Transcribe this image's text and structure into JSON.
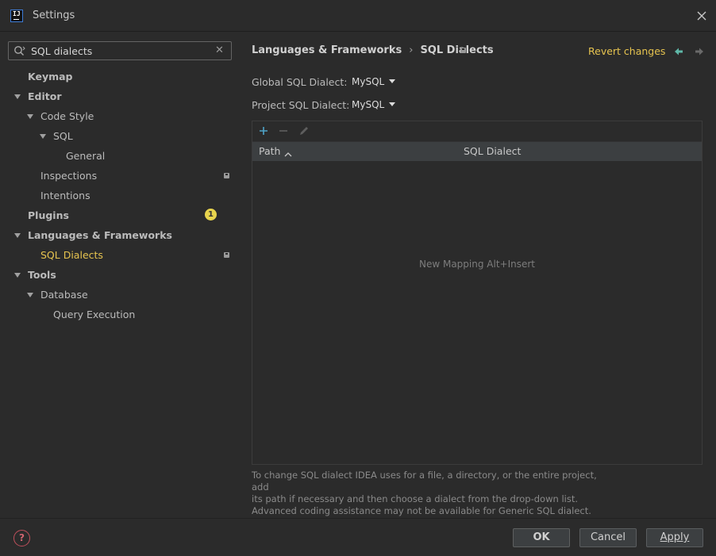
{
  "window": {
    "title": "Settings",
    "app_icon_text": "IJ"
  },
  "search": {
    "value": "SQL dialects",
    "placeholder": ""
  },
  "tree": {
    "keymap": "Keymap",
    "editor": "Editor",
    "code_style": "Code Style",
    "sql": "SQL",
    "general": "General",
    "inspections": "Inspections",
    "intentions": "Intentions",
    "plugins": "Plugins",
    "plugins_badge": "1",
    "languages": "Languages & Frameworks",
    "sql_dialects": "SQL Dialects",
    "tools": "Tools",
    "database": "Database",
    "query_execution": "Query Execution"
  },
  "header": {
    "breadcrumb_parent": "Languages & Frameworks",
    "breadcrumb_sep": "›",
    "breadcrumb_current": "SQL Dialects",
    "revert": "Revert changes"
  },
  "fields": {
    "global_label": "Global SQL Dialect:",
    "global_value": "MySQL",
    "project_label": "Project SQL Dialect:",
    "project_value": "MySQL"
  },
  "table": {
    "col_path": "Path",
    "col_dialect": "SQL Dialect",
    "empty_text": "New Mapping Alt+Insert"
  },
  "help": {
    "line1": "To change SQL dialect IDEA uses for a file, a directory, or the entire project, add",
    "line2": "its path if necessary and then choose a dialect from the drop-down list.",
    "line3": "Advanced coding assistance may not be available for Generic SQL dialect."
  },
  "footer": {
    "help_icon": "?",
    "ok": "OK",
    "cancel": "Cancel",
    "apply": "Apply"
  },
  "colors": {
    "background": "#2b2b2b",
    "accent": "#e6c34f",
    "add": "#4ea3c7",
    "nav_back": "#5fb8a8"
  }
}
